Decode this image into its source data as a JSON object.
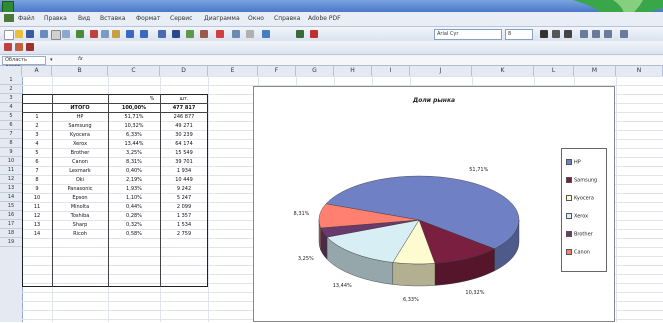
{
  "menu": [
    "Файл",
    "Правка",
    "Вид",
    "Вставка",
    "Формат",
    "Сервис",
    "Диаграмма",
    "Окно",
    "Справка",
    "Adobe PDF"
  ],
  "toolbar": {
    "font_name": "Arial Cyr",
    "font_size": "8"
  },
  "formula_bar": {
    "name_box": "Область диагр...",
    "fx": "fx",
    "content": ""
  },
  "columns": [
    "A",
    "B",
    "C",
    "D",
    "E",
    "F",
    "G",
    "H",
    "I",
    "J",
    "K",
    "L",
    "M",
    "N"
  ],
  "rows": [
    "1",
    "2",
    "3",
    "4",
    "5",
    "6",
    "7",
    "8",
    "9",
    "10",
    "11",
    "12",
    "13",
    "14",
    "15",
    "16",
    "17",
    "18",
    "19"
  ],
  "table": {
    "header": {
      "c": "%",
      "d": "шт."
    },
    "total": {
      "b": "ИТОГО",
      "c": "100,00%",
      "d": "477 817"
    },
    "rows": [
      {
        "n": "1",
        "b": "HP",
        "c": "51,71%",
        "d": "246 877"
      },
      {
        "n": "2",
        "b": "Samsung",
        "c": "10,32%",
        "d": "49 271"
      },
      {
        "n": "3",
        "b": "Kyocera",
        "c": "6,33%",
        "d": "30 239"
      },
      {
        "n": "4",
        "b": "Xerox",
        "c": "13,44%",
        "d": "64 174"
      },
      {
        "n": "5",
        "b": "Brother",
        "c": "3,25%",
        "d": "15 549"
      },
      {
        "n": "6",
        "b": "Canon",
        "c": "8,31%",
        "d": "39 701"
      },
      {
        "n": "7",
        "b": "Lexmark",
        "c": "0,40%",
        "d": "1 934"
      },
      {
        "n": "8",
        "b": "Oki",
        "c": "2,19%",
        "d": "10 449"
      },
      {
        "n": "9",
        "b": "Panasonic",
        "c": "1,93%",
        "d": "9 242"
      },
      {
        "n": "10",
        "b": "Epson",
        "c": "1,10%",
        "d": "5 247"
      },
      {
        "n": "11",
        "b": "Minolta",
        "c": "0,44%",
        "d": "2 099"
      },
      {
        "n": "12",
        "b": "Toshiba",
        "c": "0,28%",
        "d": "1 357"
      },
      {
        "n": "13",
        "b": "Sharp",
        "c": "0,32%",
        "d": "1 534"
      },
      {
        "n": "14",
        "b": "Ricoh",
        "c": "0,58%",
        "d": "2 759"
      }
    ]
  },
  "chart_data": {
    "type": "pie",
    "title": "Доли рынка",
    "categories": [
      "HP",
      "Samsung",
      "Kyocera",
      "Xerox",
      "Brother",
      "Canon"
    ],
    "values": [
      51.71,
      10.32,
      6.33,
      13.44,
      3.25,
      8.31
    ],
    "data_labels": [
      "51,71%",
      "10,32%",
      "6,33%",
      "13,44%",
      "3,25%",
      "8,31%"
    ],
    "colors": [
      "#6f80c4",
      "#7a1f3f",
      "#fffbd0",
      "#d6eef4",
      "#6a3a6a",
      "#ff8070"
    ],
    "legend": [
      "HP",
      "Samsung",
      "Kyocera",
      "Xerox",
      "Brother",
      "Canon"
    ],
    "legend_position": "right",
    "three_d": true
  }
}
